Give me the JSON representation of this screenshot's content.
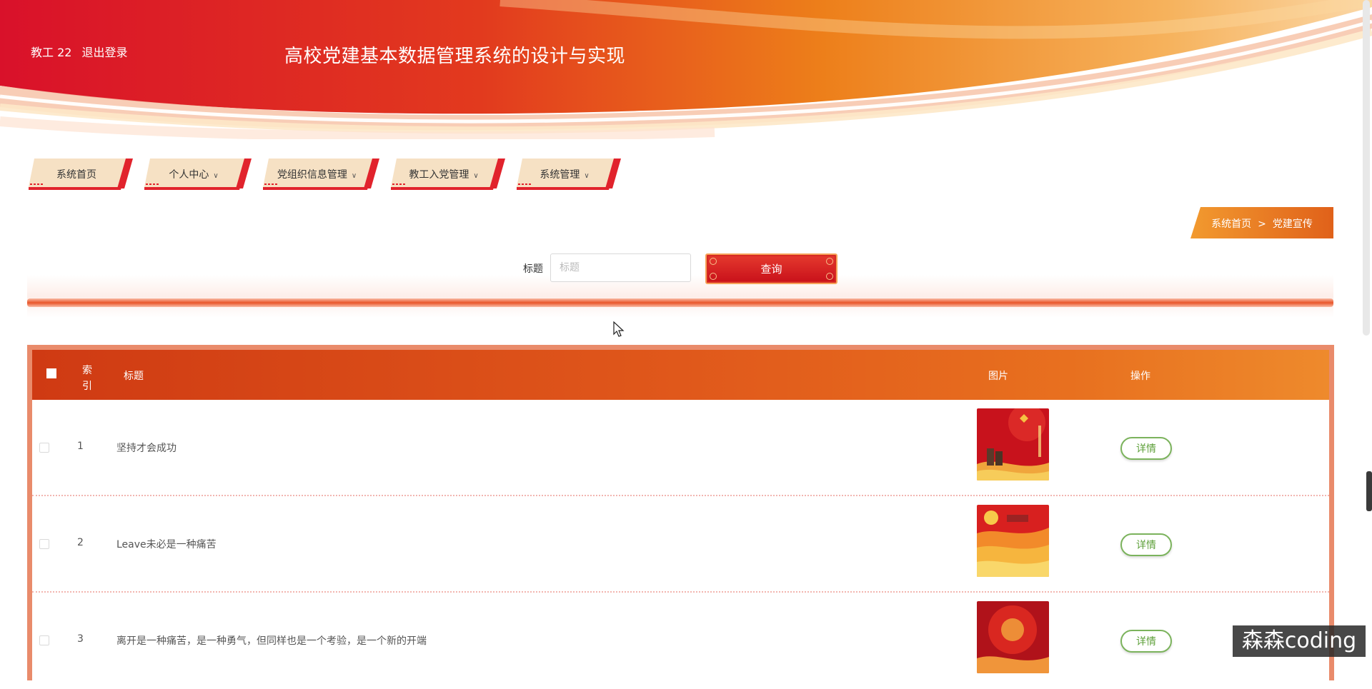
{
  "header": {
    "user": "教工 22",
    "logout": "退出登录",
    "title": "高校党建基本数据管理系统的设计与实现"
  },
  "nav": {
    "items": [
      {
        "label": "系统首页",
        "dropdown": false
      },
      {
        "label": "个人中心",
        "dropdown": true
      },
      {
        "label": "党组织信息管理",
        "dropdown": true
      },
      {
        "label": "教工入党管理",
        "dropdown": true
      },
      {
        "label": "系统管理",
        "dropdown": true
      }
    ]
  },
  "breadcrumb": {
    "home": "系统首页",
    "separator": ">",
    "current": "党建宣传"
  },
  "search": {
    "label": "标题",
    "placeholder": "标题",
    "button": "查询"
  },
  "table": {
    "headers": {
      "index": "索引",
      "title": "标题",
      "image": "图片",
      "actions": "操作"
    },
    "rows": [
      {
        "index": "1",
        "title": "坚持才会成功",
        "action": "详情"
      },
      {
        "index": "2",
        "title": "Leave未必是一种痛苦",
        "action": "详情"
      },
      {
        "index": "3",
        "title": "离开是一种痛苦，是一种勇气，但同样也是一个考验，是一个新的开端",
        "action": "详情"
      }
    ]
  },
  "watermark": "森森coding",
  "colors": {
    "primary_red": "#d8161f",
    "orange": "#e8701f",
    "detail_green": "#5ea03a"
  }
}
